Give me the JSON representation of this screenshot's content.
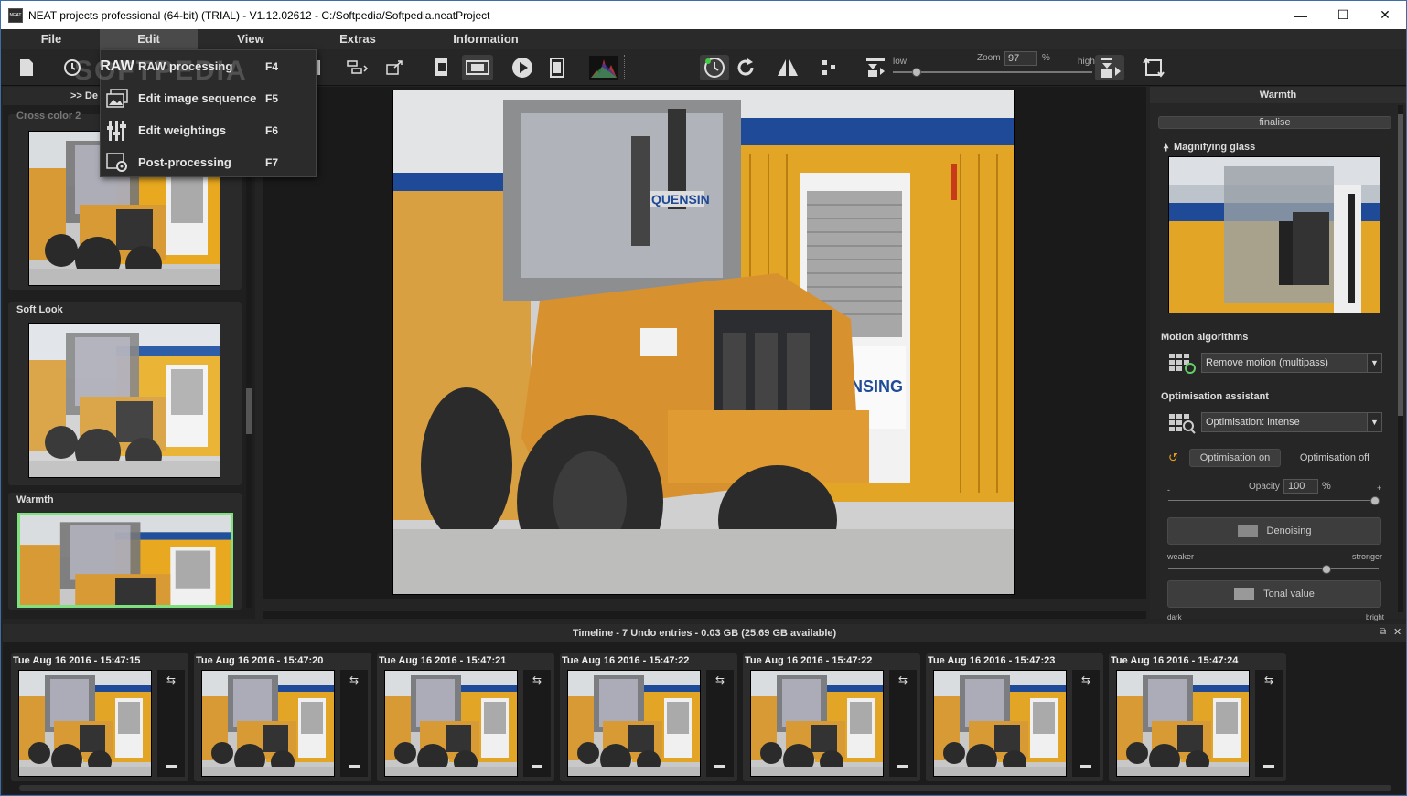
{
  "window": {
    "title": "NEAT projects professional (64-bit) (TRIAL) - V1.12.02612 - C:/Softpedia/Softpedia.neatProject",
    "app_icon_text": "NEAT"
  },
  "menubar": [
    "File",
    "Edit",
    "View",
    "Extras",
    "Information"
  ],
  "edit_menu": [
    {
      "icon": "raw-processing-icon",
      "icon_text": "RAW",
      "label": "RAW processing",
      "key": "F4"
    },
    {
      "icon": "image-sequence-icon",
      "label": "Edit image sequence",
      "key": "F5"
    },
    {
      "icon": "weightings-icon",
      "label": "Edit weightings",
      "key": "F6"
    },
    {
      "icon": "post-processing-icon",
      "label": "Post-processing",
      "key": "F7"
    }
  ],
  "watermark": "SOFTPEDIA",
  "toolbar": {
    "zoom_label": "Zoom",
    "zoom_value": "97",
    "zoom_unit": "%",
    "low": "low",
    "high": "high"
  },
  "left_panel": {
    "header": ">> De",
    "presets": [
      {
        "label": "Cross color 2"
      },
      {
        "label": "Soft Look"
      },
      {
        "label": "Warmth",
        "selected": true
      }
    ]
  },
  "right_panel": {
    "header": "Warmth",
    "finalise": "finalise",
    "magnifying_glass": "Magnifying glass",
    "motion_title": "Motion algorithms",
    "motion_value": "Remove motion (multipass)",
    "optimisation_title": "Optimisation assistant",
    "optimisation_value": "Optimisation: intense",
    "opt_on": "Optimisation on",
    "opt_off": "Optimisation off",
    "opacity_label": "Opacity",
    "opacity_value": "100",
    "opacity_unit": "%",
    "minus": "-",
    "plus": "+",
    "denoising": "Denoising",
    "weaker": "weaker",
    "stronger": "stronger",
    "tonal": "Tonal value",
    "dark": "dark",
    "bright": "bright"
  },
  "timeline": {
    "header": "Timeline - 7 Undo entries - 0.03 GB (25.69 GB available)",
    "entries": [
      "Tue Aug 16 2016 - 15:47:15",
      "Tue Aug 16 2016 - 15:47:20",
      "Tue Aug 16 2016 - 15:47:21",
      "Tue Aug 16 2016 - 15:47:22",
      "Tue Aug 16 2016 - 15:47:22",
      "Tue Aug 16 2016 - 15:47:23",
      "Tue Aug 16 2016 - 15:47:24"
    ]
  },
  "colors": {
    "accent_selected": "#7ee07e",
    "container_yellow": "#e8a920",
    "container_blue": "#1f4f9f",
    "machine_orange": "#d89a35"
  }
}
